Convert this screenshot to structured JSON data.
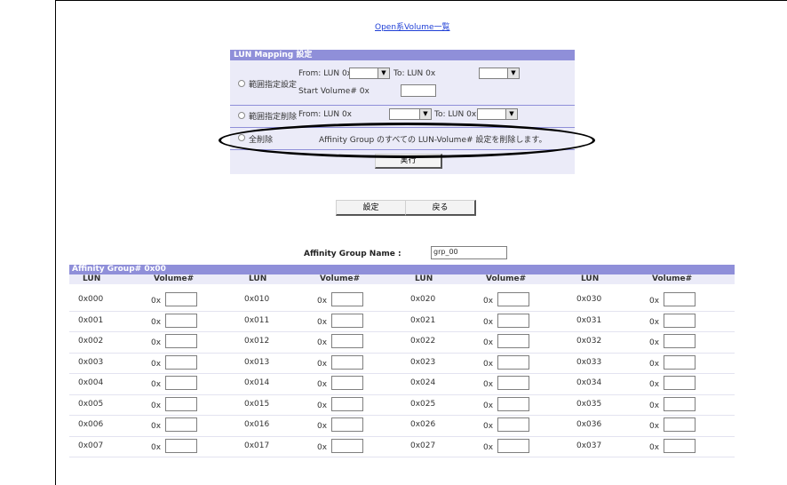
{
  "top_link": "Open系Volume一覧",
  "mapping": {
    "title": "LUN Mapping 設定",
    "range_set": {
      "label": "範囲指定設定",
      "from_label": "From: LUN 0x",
      "to_label": "To: LUN 0x",
      "start_label": "Start Volume# 0x"
    },
    "range_delete": {
      "label": "範囲指定削除",
      "from_label": "From: LUN 0x",
      "to_label": "To: LUN 0x"
    },
    "delete_all": {
      "label": "全削除",
      "description": "Affinity Group のすべての LUN-Volume# 設定を削除します。"
    },
    "execute_label": "実行"
  },
  "actions": {
    "set_label": "設定",
    "back_label": "戻る"
  },
  "group_name": {
    "label": "Affinity Group Name :",
    "value": "grp_00"
  },
  "table": {
    "title": "Affinity Group# 0x00",
    "col_lun": "LUN",
    "col_volume": "Volume#",
    "prefix": "0x",
    "columns": [
      [
        "0x000",
        "0x001",
        "0x002",
        "0x003",
        "0x004",
        "0x005",
        "0x006",
        "0x007"
      ],
      [
        "0x010",
        "0x011",
        "0x012",
        "0x013",
        "0x014",
        "0x015",
        "0x016",
        "0x017"
      ],
      [
        "0x020",
        "0x021",
        "0x022",
        "0x023",
        "0x024",
        "0x025",
        "0x026",
        "0x027"
      ],
      [
        "0x030",
        "0x031",
        "0x032",
        "0x033",
        "0x034",
        "0x035",
        "0x036",
        "0x037"
      ]
    ]
  }
}
